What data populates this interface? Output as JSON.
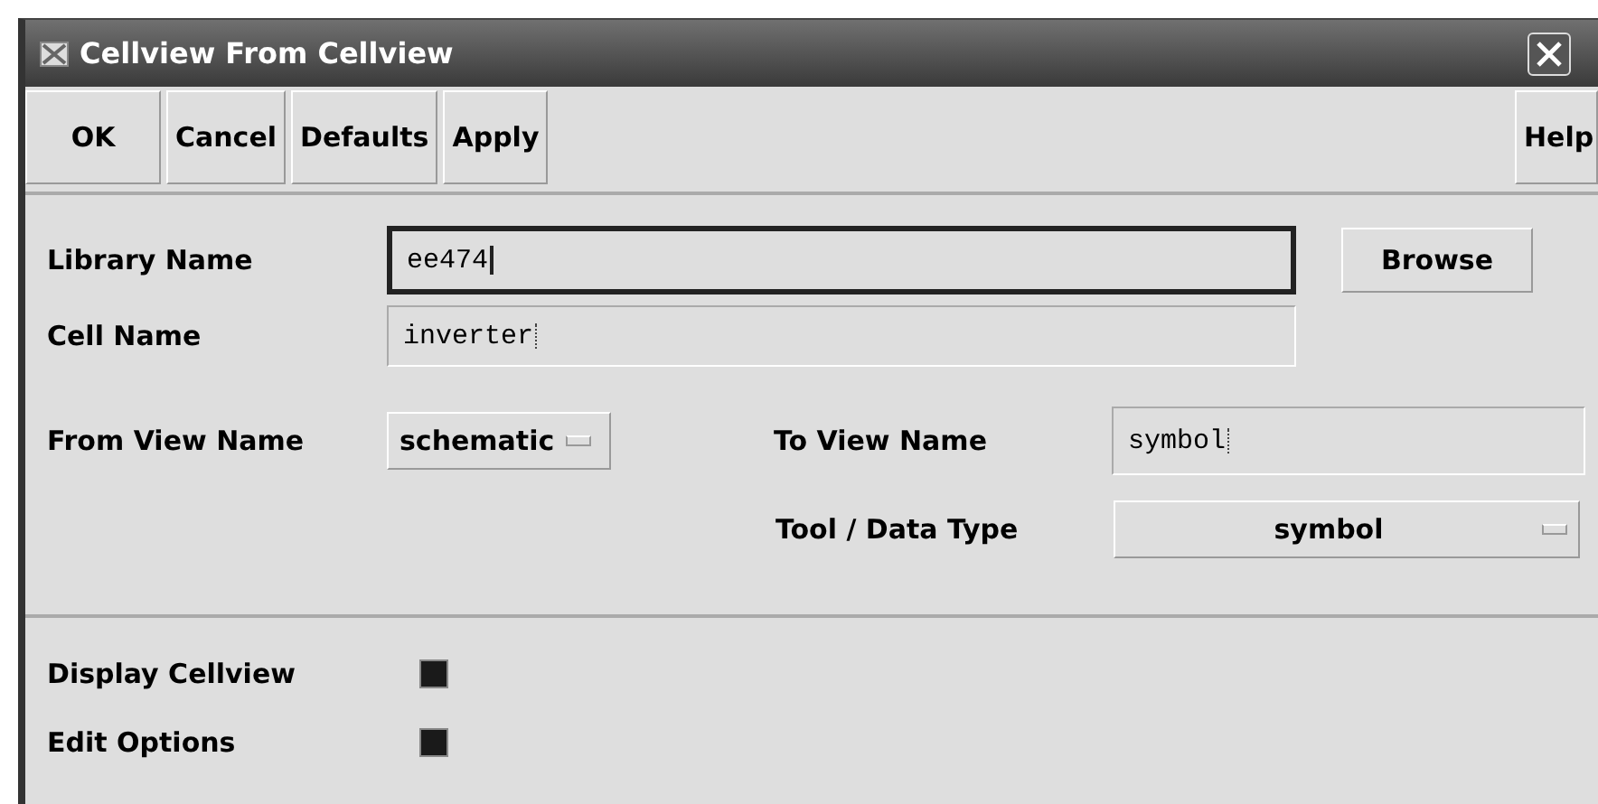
{
  "window": {
    "title": "Cellview From Cellview"
  },
  "buttons": [
    {
      "label": "OK"
    },
    {
      "label": "Cancel"
    },
    {
      "label": "Defaults"
    },
    {
      "label": "Apply"
    }
  ],
  "help_button": {
    "label": "Help"
  },
  "library_name": {
    "label": "Library Name",
    "value": "ee474",
    "focused": true
  },
  "browse_button": {
    "label": "Browse"
  },
  "cell_name": {
    "label": "Cell Name",
    "value": "inverter",
    "focused": false
  },
  "from_view_name": {
    "label": "From View Name",
    "value": "schematic"
  },
  "to_view_name": {
    "label": "To View Name",
    "value": "symbol",
    "focused": false
  },
  "tool_data_type": {
    "label": "Tool / Data Type",
    "value": "symbol"
  },
  "options": [
    {
      "label": "Display Cellview",
      "checked": true
    },
    {
      "label": "Edit Options",
      "checked": true
    }
  ]
}
